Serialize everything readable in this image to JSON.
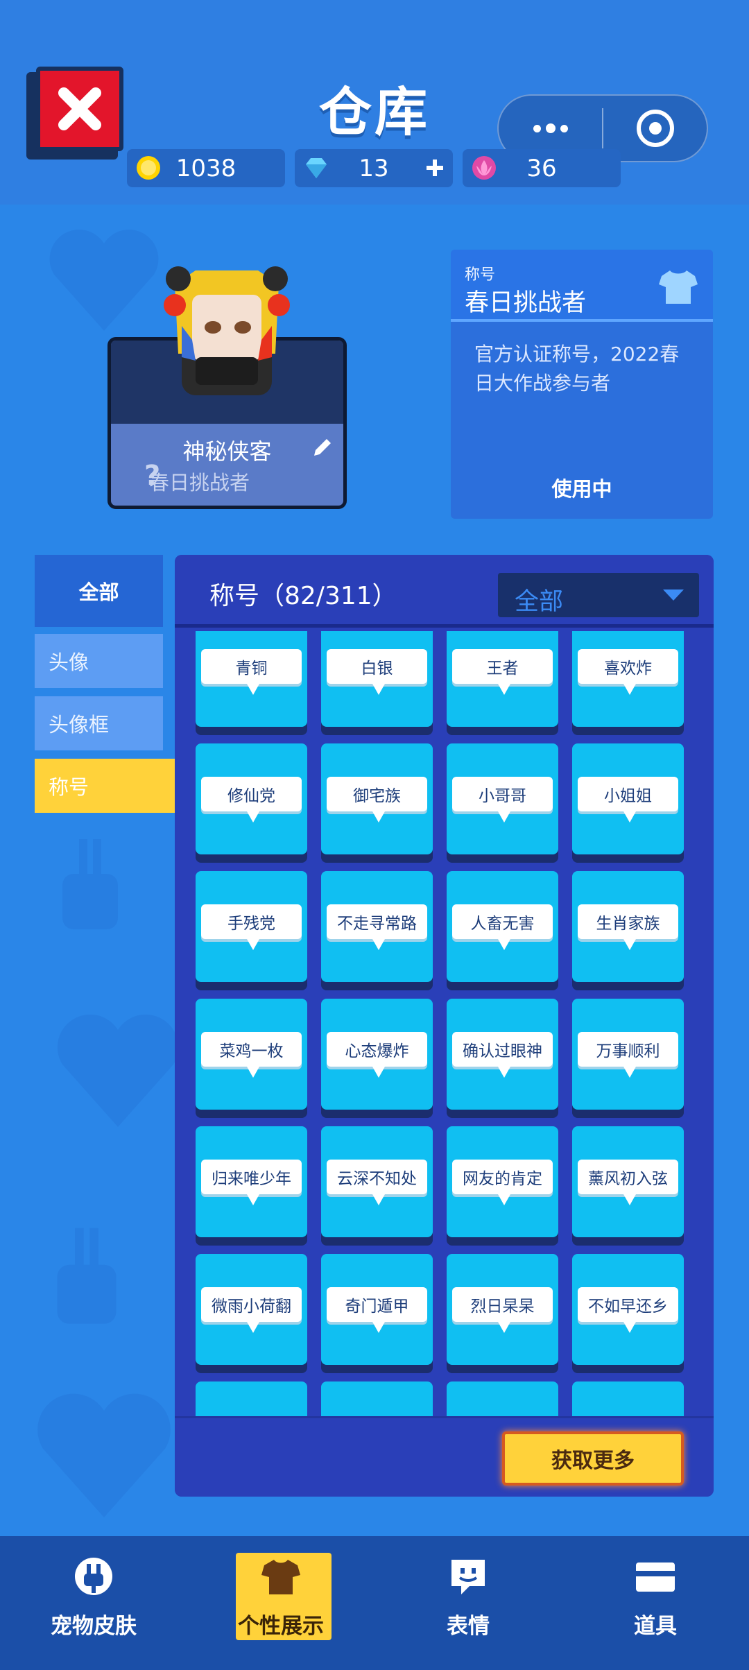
{
  "header": {
    "title": "仓库",
    "close_icon": "close-icon",
    "more_icon": "more-icon",
    "target_icon": "target-icon"
  },
  "currencies": [
    {
      "name": "gold-coin",
      "value": "1038",
      "color": "#ffd400"
    },
    {
      "name": "diamond",
      "value": "13",
      "color": "#6ad5ff"
    },
    {
      "name": "lotus",
      "value": "36",
      "color": "#e04aa6"
    }
  ],
  "profile": {
    "name": "神秘侠客",
    "title": "春日挑战者",
    "question_mark": "?"
  },
  "title_card": {
    "label": "称号",
    "name": "春日挑战者",
    "description": "官方认证称号，2022春日大作战参与者",
    "status": "使用中"
  },
  "sidebar": {
    "all": "全部",
    "items": [
      "头像",
      "头像框",
      "称号"
    ]
  },
  "panel": {
    "title": "称号（82/311）",
    "filter": "全部",
    "get_more": "获取更多",
    "titles": [
      "青铜",
      "白银",
      "王者",
      "喜欢炸",
      "修仙党",
      "御宅族",
      "小哥哥",
      "小姐姐",
      "手残党",
      "不走寻常路",
      "人畜无害",
      "生肖家族",
      "菜鸡一枚",
      "心态爆炸",
      "确认过眼神",
      "万事顺利",
      "归来唯少年",
      "云深不知处",
      "网友的肯定",
      "薰风初入弦",
      "微雨小荷翻",
      "奇门遁甲",
      "烈日杲杲",
      "不如早还乡",
      "",
      "",
      "",
      ""
    ]
  },
  "bottom_nav": [
    {
      "label": "宠物皮肤",
      "icon": "pet-skin-icon"
    },
    {
      "label": "个性展示",
      "icon": "shirt-icon"
    },
    {
      "label": "表情",
      "icon": "emoji-icon"
    },
    {
      "label": "道具",
      "icon": "card-icon"
    }
  ]
}
